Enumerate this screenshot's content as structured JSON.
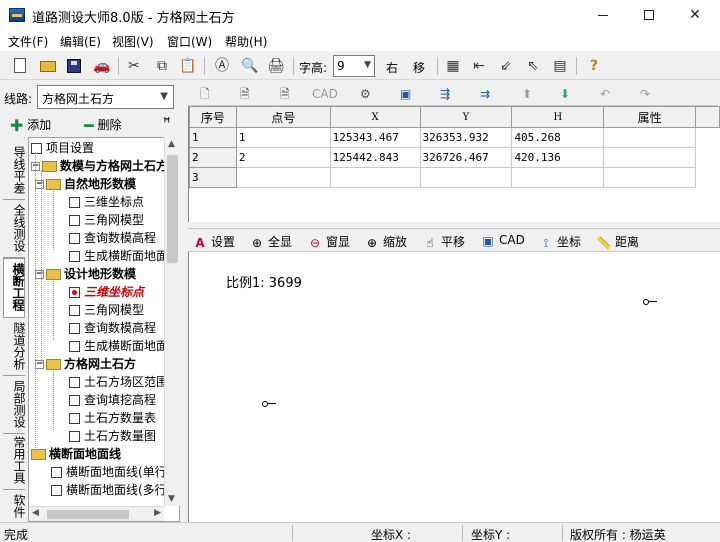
{
  "window": {
    "title": "道路测设大师8.0版 - 方格网土石方"
  },
  "menu": [
    "文件(F)",
    "编辑(E)",
    "视图(V)",
    "窗口(W)",
    "帮助(H)"
  ],
  "toolbar": {
    "font_label": "字高:",
    "font_value": "9",
    "right_label": "右",
    "move_label": "移",
    "help_glyph": "?"
  },
  "left": {
    "route_label": "线路:",
    "route_value": "方格网土石方",
    "add_label": "添加",
    "delete_label": "删除",
    "vtabs": [
      "导线平差",
      "全线测设",
      "横断工程",
      "隧道分析",
      "局部测设",
      "常用工具",
      "软件"
    ],
    "tree": [
      {
        "text": "项目设置"
      },
      {
        "text": "数模与方格网土石方"
      },
      {
        "text": "自然地形数模"
      },
      {
        "text": "三维坐标点"
      },
      {
        "text": "三角网模型"
      },
      {
        "text": "查询数模高程"
      },
      {
        "text": "生成横断面地面"
      },
      {
        "text": "设计地形数模"
      },
      {
        "text": "三维坐标点"
      },
      {
        "text": "三角网模型"
      },
      {
        "text": "查询数模高程"
      },
      {
        "text": "生成横断面地面"
      },
      {
        "text": "方格网土石方"
      },
      {
        "text": "土石方场区范围"
      },
      {
        "text": "查询填挖高程"
      },
      {
        "text": "土石方数量表"
      },
      {
        "text": "土石方数量图"
      },
      {
        "text": "横断面地面线"
      },
      {
        "text": "横断面地面线(单行"
      },
      {
        "text": "横断面地面线(多行"
      }
    ]
  },
  "grid": {
    "toolbar": {
      "cad_label": "CAD"
    },
    "columns": [
      "序号",
      "点号",
      "X",
      "Y",
      "H",
      "属性"
    ],
    "rows": [
      [
        "1",
        "1",
        "125343.467",
        "326353.932",
        "405.268",
        ""
      ],
      [
        "2",
        "2",
        "125442.843",
        "326726.467",
        "420.136",
        ""
      ],
      [
        "3",
        "",
        "",
        "",
        "",
        ""
      ]
    ]
  },
  "draw": {
    "toolbar": [
      "设置",
      "全显",
      "窗显",
      "缩放",
      "平移",
      "CAD",
      "坐标",
      "距离"
    ],
    "scale_text": "比例1: 3699"
  },
  "status": {
    "ready": "完成",
    "coord_x": "坐标X :",
    "coord_y": "坐标Y :",
    "copyright": "版权所有 : 杨运英"
  }
}
